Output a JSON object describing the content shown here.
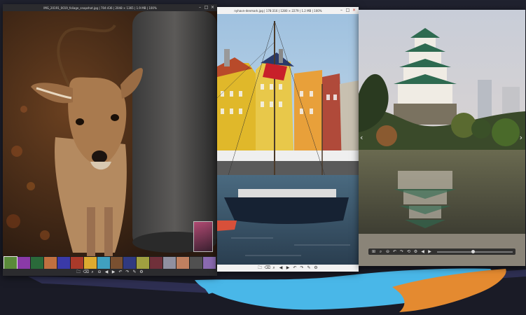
{
  "windows": [
    {
      "title": "IMG_20191_0019_foliage_snapshot.jpg | 704:436 | 2048 × 1365 | 1.9 MB | 100%",
      "controls": [
        "–",
        "□",
        "×"
      ],
      "toolbar": [
        "🗀",
        "⌫",
        "⌕",
        "⊖",
        "◀",
        "▶",
        "↶",
        "↷",
        "✎",
        "⚙"
      ],
      "thumb_colors": [
        "#5a8a3a",
        "#8a3aa8",
        "#2a6a3a",
        "#c07040",
        "#3a3aa8",
        "#aa3a2a",
        "#ddaa30",
        "#40a0c0",
        "#7a5030",
        "#303a80",
        "#a0a040",
        "#70303a",
        "#9090a0",
        "#c08060",
        "#505050",
        "#8a6ab0"
      ]
    },
    {
      "title": "nyhavn-denmark.jpg | 178:316 | 1280 × 2279 | 1.2 MB | 100%",
      "controls": [
        "–",
        "□",
        "×"
      ],
      "toolbar": [
        "🗀",
        "⌫",
        "⌕",
        "◀",
        "▶",
        "↶",
        "↷",
        "✎",
        "⚙"
      ]
    },
    {
      "title": "",
      "toolbar": [
        "⊞",
        "⌕",
        "⊖",
        "↶",
        "↷",
        "⟲",
        "⚙",
        "◀",
        "▶"
      ],
      "nav": {
        "prev": "‹",
        "next": "›"
      }
    }
  ]
}
